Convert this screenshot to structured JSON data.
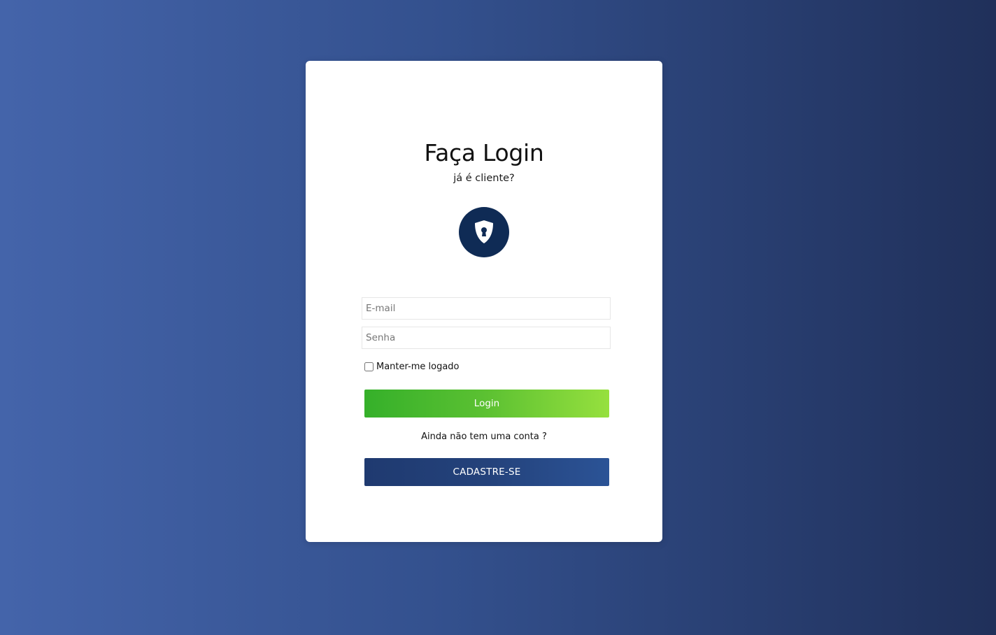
{
  "login_card": {
    "title": "Faça Login",
    "subtitle": "já é cliente?",
    "icon": "shield-keyhole-icon",
    "email_placeholder": "E-mail",
    "password_placeholder": "Senha",
    "remember_label": "Manter-me logado",
    "login_button": "Login",
    "no_account_text": "Ainda não tem uma conta ?",
    "register_button": "CADASTRE-SE"
  },
  "colors": {
    "background_start": "#4464aa",
    "background_end": "#20305a",
    "icon_circle": "#0f2b55",
    "login_button_start": "#35b02a",
    "login_button_end": "#96e03e",
    "register_button_start": "#1f3a70",
    "register_button_end": "#2b5396"
  }
}
